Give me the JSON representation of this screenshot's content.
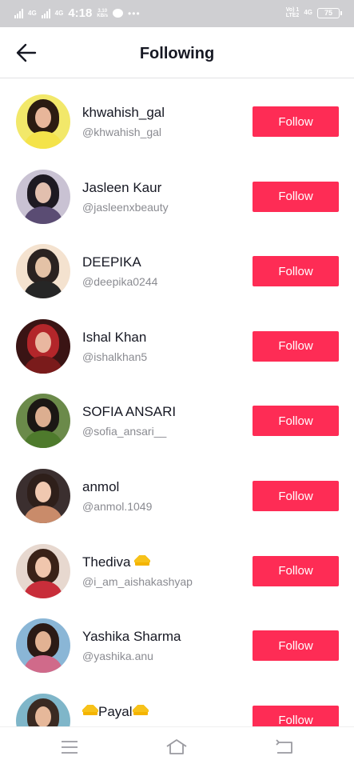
{
  "status_bar": {
    "network_1": "4G",
    "network_2": "4G",
    "time": "4:18",
    "speed_value": "3.10",
    "speed_unit": "KB/s",
    "overflow": "•••",
    "volte_top": "Vo) 1",
    "volte_bottom": "LTE2",
    "network_3": "4G",
    "battery": "75"
  },
  "header": {
    "title": "Following"
  },
  "following": [
    {
      "name": "khwahish_gal",
      "handle": "@khwahish_gal",
      "button": "Follow",
      "avatar_bg": "#f2e86a",
      "hair": "#2b1b12",
      "skin": "#e8b69a",
      "outfit": "#f4e34a"
    },
    {
      "name": "Jasleen Kaur",
      "handle": "@jasleenxbeauty",
      "button": "Follow",
      "avatar_bg": "#c9c2d3",
      "hair": "#1e1a22",
      "skin": "#e2bfae",
      "outfit": "#5a4c73"
    },
    {
      "name": "DEEPIKA",
      "handle": "@deepika0244",
      "button": "Follow",
      "avatar_bg": "#f4e2cf",
      "hair": "#2a2220",
      "skin": "#e4c2a6",
      "outfit": "#262626"
    },
    {
      "name": "Ishal Khan",
      "handle": "@ishalkhan5",
      "button": "Follow",
      "avatar_bg": "#3a1414",
      "hair": "#b3262a",
      "skin": "#e9b7a0",
      "outfit": "#7a1b1b"
    },
    {
      "name": "SOFIA ANSARI",
      "handle": "@sofia_ansari__",
      "button": "Follow",
      "avatar_bg": "#6b8a4a",
      "hair": "#1b1714",
      "skin": "#dcae90",
      "outfit": "#4e7a2c"
    },
    {
      "name": "anmol",
      "handle": "@anmol.1049",
      "button": "Follow",
      "avatar_bg": "#3b2f2f",
      "hair": "#2e1f1a",
      "skin": "#f0c8b0",
      "outfit": "#c98b6a"
    },
    {
      "name": "Thediva",
      "handle": "@i_am_aishakashyap",
      "button": "Follow",
      "crown": true,
      "avatar_bg": "#e7d8cf",
      "hair": "#3a2218",
      "skin": "#f0c6ad",
      "outfit": "#c82e3a"
    },
    {
      "name": "Yashika Sharma",
      "handle": "@yashika.anu",
      "button": "Follow",
      "avatar_bg": "#8ab6d6",
      "hair": "#2b1a15",
      "skin": "#e2b293",
      "outfit": "#d06a8a"
    },
    {
      "name": "Payal",
      "handle": "",
      "button": "Follow",
      "crown_both": true,
      "avatar_bg": "#7fb6c9",
      "hair": "#3a2a22",
      "skin": "#e6b89a",
      "outfit": "#4a8fb0"
    }
  ],
  "nav": {
    "icons": [
      "menu-icon",
      "home-icon",
      "back-icon"
    ]
  }
}
